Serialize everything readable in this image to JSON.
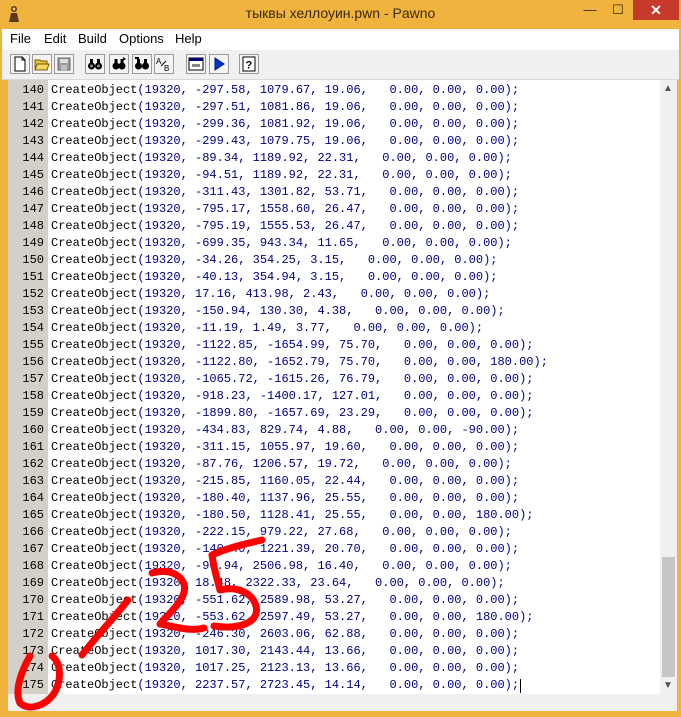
{
  "window": {
    "title": "тыквы хеллоуин.pwn - Pawno",
    "minimize_glyph": "—",
    "maximize_glyph": "☐",
    "close_glyph": "✕",
    "accent_color": "#f0b33d",
    "close_color": "#c7392b"
  },
  "menu": {
    "items": [
      "File",
      "Edit",
      "Build",
      "Options",
      "Help"
    ]
  },
  "toolbar": {
    "buttons": [
      {
        "icon": "new-file-icon"
      },
      {
        "icon": "open-folder-icon"
      },
      {
        "icon": "save-disk-icon"
      },
      {
        "icon": "find-binoculars-icon"
      },
      {
        "icon": "find-next-binoculars-icon"
      },
      {
        "icon": "replace-binoculars-icon"
      },
      {
        "icon": "replace-ab-icon"
      },
      {
        "icon": "compile-window-icon"
      },
      {
        "icon": "run-play-icon"
      },
      {
        "icon": "help-question-icon"
      }
    ]
  },
  "editor": {
    "lines": [
      {
        "n": "140",
        "text": "CreateObject(19320, -297.58, 1079.67, 19.06,   0.00, 0.00, 0.00);"
      },
      {
        "n": "141",
        "text": "CreateObject(19320, -297.51, 1081.86, 19.06,   0.00, 0.00, 0.00);"
      },
      {
        "n": "142",
        "text": "CreateObject(19320, -299.36, 1081.92, 19.06,   0.00, 0.00, 0.00);"
      },
      {
        "n": "143",
        "text": "CreateObject(19320, -299.43, 1079.75, 19.06,   0.00, 0.00, 0.00);"
      },
      {
        "n": "144",
        "text": "CreateObject(19320, -89.34, 1189.92, 22.31,   0.00, 0.00, 0.00);"
      },
      {
        "n": "145",
        "text": "CreateObject(19320, -94.51, 1189.92, 22.31,   0.00, 0.00, 0.00);"
      },
      {
        "n": "146",
        "text": "CreateObject(19320, -311.43, 1301.82, 53.71,   0.00, 0.00, 0.00);"
      },
      {
        "n": "147",
        "text": "CreateObject(19320, -795.17, 1558.60, 26.47,   0.00, 0.00, 0.00);"
      },
      {
        "n": "148",
        "text": "CreateObject(19320, -795.19, 1555.53, 26.47,   0.00, 0.00, 0.00);"
      },
      {
        "n": "149",
        "text": "CreateObject(19320, -699.35, 943.34, 11.65,   0.00, 0.00, 0.00);"
      },
      {
        "n": "150",
        "text": "CreateObject(19320, -34.26, 354.25, 3.15,   0.00, 0.00, 0.00);"
      },
      {
        "n": "151",
        "text": "CreateObject(19320, -40.13, 354.94, 3.15,   0.00, 0.00, 0.00);"
      },
      {
        "n": "152",
        "text": "CreateObject(19320, 17.16, 413.98, 2.43,   0.00, 0.00, 0.00);"
      },
      {
        "n": "153",
        "text": "CreateObject(19320, -150.94, 130.30, 4.38,   0.00, 0.00, 0.00);"
      },
      {
        "n": "154",
        "text": "CreateObject(19320, -11.19, 1.49, 3.77,   0.00, 0.00, 0.00);"
      },
      {
        "n": "155",
        "text": "CreateObject(19320, -1122.85, -1654.99, 75.70,   0.00, 0.00, 0.00);"
      },
      {
        "n": "156",
        "text": "CreateObject(19320, -1122.80, -1652.79, 75.70,   0.00, 0.00, 180.00);"
      },
      {
        "n": "157",
        "text": "CreateObject(19320, -1065.72, -1615.26, 76.79,   0.00, 0.00, 0.00);"
      },
      {
        "n": "158",
        "text": "CreateObject(19320, -918.23, -1400.17, 127.01,   0.00, 0.00, 0.00);"
      },
      {
        "n": "159",
        "text": "CreateObject(19320, -1899.80, -1657.69, 23.29,   0.00, 0.00, 0.00);"
      },
      {
        "n": "160",
        "text": "CreateObject(19320, -434.83, 829.74, 4.88,   0.00, 0.00, -90.00);"
      },
      {
        "n": "161",
        "text": "CreateObject(19320, -311.15, 1055.97, 19.60,   0.00, 0.00, 0.00);"
      },
      {
        "n": "162",
        "text": "CreateObject(19320, -87.76, 1206.57, 19.72,   0.00, 0.00, 0.00);"
      },
      {
        "n": "163",
        "text": "CreateObject(19320, -215.85, 1160.05, 22.44,   0.00, 0.00, 0.00);"
      },
      {
        "n": "164",
        "text": "CreateObject(19320, -180.40, 1137.96, 25.55,   0.00, 0.00, 0.00);"
      },
      {
        "n": "165",
        "text": "CreateObject(19320, -180.50, 1128.41, 25.55,   0.00, 0.00, 180.00);"
      },
      {
        "n": "166",
        "text": "CreateObject(19320, -222.15, 979.22, 27.68,   0.00, 0.00, 0.00);"
      },
      {
        "n": "167",
        "text": "CreateObject(19320, -140.40, 1221.39, 20.70,   0.00, 0.00, 0.00);"
      },
      {
        "n": "168",
        "text": "CreateObject(19320, -90.94, 2506.98, 16.40,   0.00, 0.00, 0.00);"
      },
      {
        "n": "169",
        "text": "CreateObject(19320, 18.48, 2322.33, 23.64,   0.00, 0.00, 0.00);"
      },
      {
        "n": "170",
        "text": "CreateObject(19320, -551.62, 2589.98, 53.27,   0.00, 0.00, 0.00);"
      },
      {
        "n": "171",
        "text": "CreateObject(19320, -553.62, 2597.49, 53.27,   0.00, 0.00, 180.00);"
      },
      {
        "n": "172",
        "text": "CreateObject(19320, -246.30, 2603.06, 62.88,   0.00, 0.00, 0.00);"
      },
      {
        "n": "173",
        "text": "CreateObject(19320, 1017.30, 2143.44, 13.66,   0.00, 0.00, 0.00);"
      },
      {
        "n": "174",
        "text": "CreateObject(19320, 1017.25, 2123.13, 13.66,   0.00, 0.00, 0.00);"
      },
      {
        "n": "175",
        "text": "CreateObject(19320, 2237.57, 2723.45, 14.14,   0.00, 0.00, 0.00);"
      }
    ],
    "gutter_color": "#d4d0c8",
    "number_color": "#000080"
  },
  "annotation": {
    "text": "175",
    "color": "#ff0000"
  }
}
